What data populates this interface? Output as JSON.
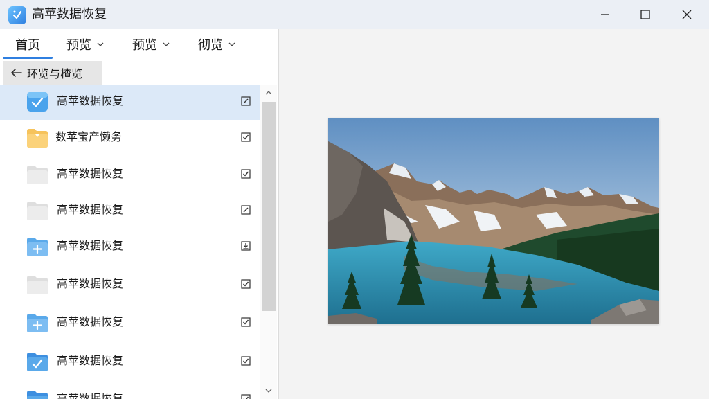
{
  "window": {
    "title": "高苹数据恢复",
    "controls": [
      "minimize-icon",
      "maximize-icon",
      "close-icon"
    ]
  },
  "tabs": [
    {
      "label": "首页",
      "active": true,
      "dropdown": false
    },
    {
      "label": "预览",
      "active": false,
      "dropdown": true
    },
    {
      "label": "预览",
      "active": false,
      "dropdown": true
    },
    {
      "label": "彻览",
      "active": false,
      "dropdown": true
    }
  ],
  "back": {
    "label": "环览与楂览",
    "icon": "arrow-left-icon"
  },
  "list": [
    {
      "name": "高苹数据恢复",
      "icon": "app-folder-icon",
      "status": "edit-icon",
      "selected": true
    },
    {
      "name": "数苹宝产懒务",
      "icon": "yellow-folder-icon",
      "status": "check-icon",
      "selected": false
    },
    {
      "name": "高苹数据恢复",
      "icon": "gray-folder-icon",
      "status": "check-icon",
      "selected": false
    },
    {
      "name": "高苹数据恢复",
      "icon": "gray-folder-icon",
      "status": "edit-icon",
      "selected": false
    },
    {
      "name": "高苹数据恢复",
      "icon": "blue-plus-folder-icon",
      "status": "download-icon",
      "selected": false
    },
    {
      "name": "高苹数据恢复",
      "icon": "gray-folder-icon",
      "status": "check-icon",
      "selected": false
    },
    {
      "name": "高苹数据恢复",
      "icon": "blue-plus-folder-icon",
      "status": "check-icon",
      "selected": false
    },
    {
      "name": "高苹数据恢复",
      "icon": "app-folder-icon",
      "status": "check-icon",
      "selected": false
    },
    {
      "name": "高苹数据恢复",
      "icon": "app-folder-icon",
      "status": "check-icon",
      "selected": false
    }
  ],
  "preview": {
    "image": "mountain-lake-landscape"
  },
  "colors": {
    "accent": "#2f7fe0",
    "selected_row": "#dce9f8",
    "titlebar": "#ebeff5"
  }
}
